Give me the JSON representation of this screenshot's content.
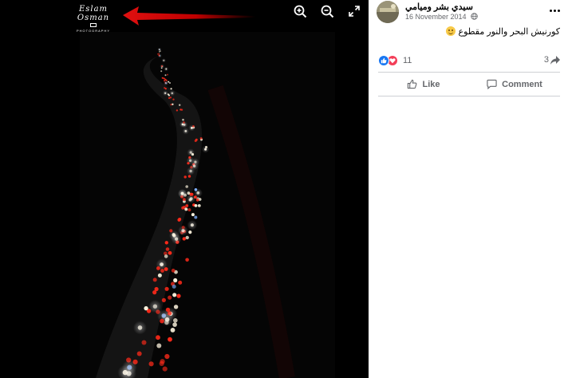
{
  "photo": {
    "watermark_name": "Eslam Osman",
    "watermark_sub": "PHOTOGRAPHY"
  },
  "toolbar": {
    "zoom_in_icon": "zoom-in-icon",
    "zoom_out_icon": "zoom-out-icon",
    "fullscreen_icon": "fullscreen-icon"
  },
  "post": {
    "author": "سيدي بشر وميامي",
    "date": "16 November 2014",
    "caption": "كورنيش البحر والنور مقطوع",
    "reaction_count": "11",
    "share_count": "3"
  },
  "actions": {
    "like_label": "Like",
    "comment_label": "Comment"
  },
  "colors": {
    "facebook_blue": "#1877f2",
    "love_red": "#f33e58",
    "secondary_text": "#65676b",
    "annotation_arrow": "#e01010"
  }
}
